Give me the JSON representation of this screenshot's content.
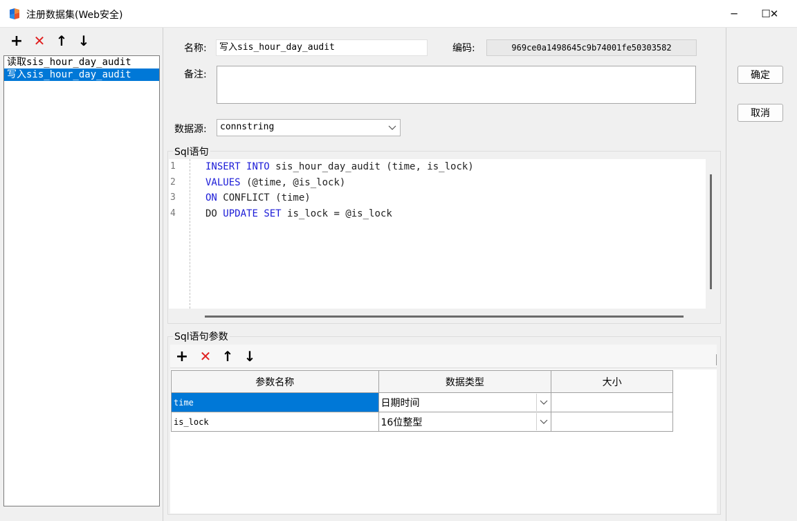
{
  "window": {
    "title": "注册数据集(Web安全)",
    "minimize_icon": "─",
    "maximize_icon": "☐",
    "close_icon": "✕"
  },
  "toolbar_icons": {
    "add": "+",
    "delete": "✕",
    "up": "↑",
    "down": "↓"
  },
  "datasets": [
    {
      "label": "读取sis_hour_day_audit"
    },
    {
      "label": "写入sis_hour_day_audit"
    }
  ],
  "form": {
    "name_label": "名称:",
    "name_value": "写入sis_hour_day_audit",
    "code_label": "编码:",
    "code_value": "969ce0a1498645c9b74001fe50303582",
    "remark_label": "备注:",
    "remark_value": "",
    "datasource_label": "数据源:",
    "datasource_value": "connstring"
  },
  "sql": {
    "group_title": "Sql语句",
    "lines": [
      {
        "num": "1",
        "tokens": [
          {
            "t": "INSERT",
            "kw": true
          },
          {
            "t": " "
          },
          {
            "t": "INTO",
            "kw": true
          },
          {
            "t": " sis_hour_day_audit (time, is_lock)"
          }
        ]
      },
      {
        "num": "2",
        "tokens": [
          {
            "t": "VALUES",
            "kw": true
          },
          {
            "t": " (@time, @is_lock)"
          }
        ]
      },
      {
        "num": "3",
        "tokens": [
          {
            "t": "ON",
            "kw": true
          },
          {
            "t": " CONFLICT (time)"
          }
        ]
      },
      {
        "num": "4",
        "tokens": [
          {
            "t": "DO "
          },
          {
            "t": "UPDATE",
            "kw": true
          },
          {
            "t": " "
          },
          {
            "t": "SET",
            "kw": true
          },
          {
            "t": " is_lock = @is_lock"
          }
        ]
      }
    ]
  },
  "params": {
    "group_title": "Sql语句参数",
    "columns": [
      "参数名称",
      "数据类型",
      "大小"
    ],
    "rows": [
      {
        "name": "time",
        "type": "日期时间",
        "size": ""
      },
      {
        "name": "is_lock",
        "type": "16位整型",
        "size": ""
      }
    ]
  },
  "buttons": {
    "ok": "确定",
    "cancel": "取消"
  },
  "colors": {
    "selection": "#0078d7",
    "keyword": "#1b1bd7",
    "delete_icon": "#e02020"
  }
}
